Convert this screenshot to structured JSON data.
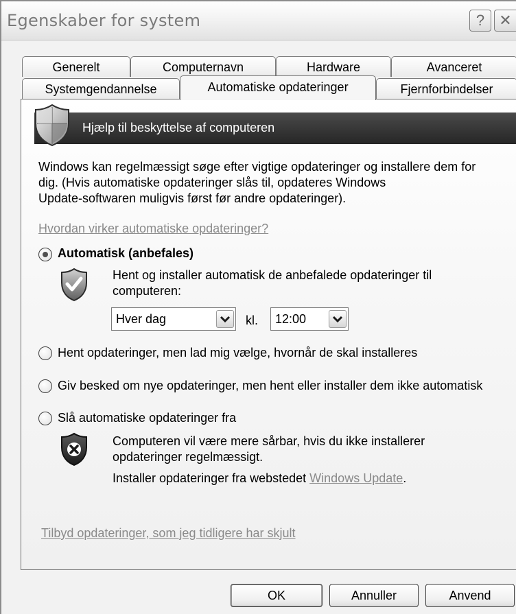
{
  "window": {
    "title": "Egenskaber for system",
    "help_glyph": "?",
    "close_glyph": "✕"
  },
  "tabs": {
    "row1": [
      "Generelt",
      "Computernavn",
      "Hardware",
      "Avanceret"
    ],
    "row2": [
      "Systemgendannelse",
      "Automatiske opdateringer",
      "Fjernforbindelser"
    ],
    "active": "Automatiske opdateringer"
  },
  "panel": {
    "banner_title": "Hjælp til beskyttelse af computeren",
    "banner_icon": "security-shield-icon",
    "intro_lines": [
      "Windows kan regelmæssigt søge efter vigtige opdateringer og installere dem for",
      "dig. (Hvis automatiske opdateringer slås til, opdateres Windows",
      "Update-softwaren muligvis først før andre opdateringer)."
    ],
    "help_link": "Hvordan virker automatiske opdateringer?",
    "options": {
      "automatic": {
        "label": "Automatisk (anbefales)",
        "checked": true,
        "icon": "shield-check-icon",
        "description_lines": [
          "Hent og installer automatisk de anbefalede opdateringer til",
          "computeren:"
        ],
        "frequency": "Hver dag",
        "time_prefix": "kl.",
        "time": "12:00"
      },
      "download_only": {
        "label": "Hent opdateringer, men lad mig vælge, hvornår de skal installeres",
        "checked": false
      },
      "notify_only": {
        "label": "Giv besked om nye opdateringer, men hent eller installer dem ikke automatisk",
        "checked": false
      },
      "off": {
        "label": "Slå automatiske opdateringer fra",
        "checked": false,
        "icon": "shield-x-icon",
        "warning_lines": [
          "Computeren vil være mere sårbar, hvis du ikke installerer",
          "opdateringer regelmæssigt."
        ],
        "install_from_prefix": "Installer opdateringer fra webstedet ",
        "install_from_link": "Windows Update",
        "install_from_suffix": "."
      }
    },
    "hidden_updates_link": "Tilbyd opdateringer, som jeg tidligere har skjult"
  },
  "buttons": {
    "ok": "OK",
    "cancel": "Annuller",
    "apply": "Anvend"
  }
}
